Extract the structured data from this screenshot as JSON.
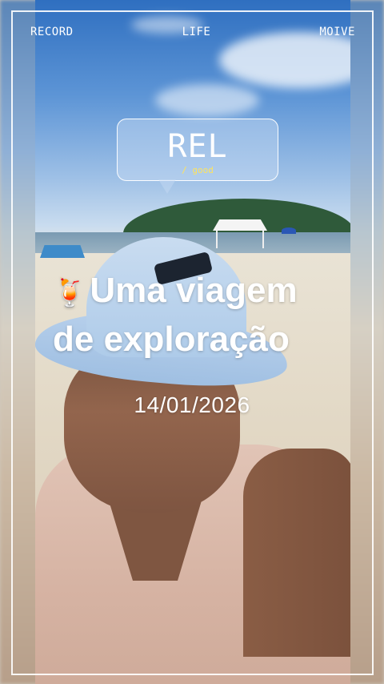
{
  "topbar": {
    "left": "RECORD",
    "center": "LIFE",
    "right": "MOIVE"
  },
  "bubble": {
    "title": "REL",
    "subtitle": "/ good"
  },
  "headline": {
    "emoji": "🍹",
    "line1": "Uma viagem",
    "line2": "de exploração"
  },
  "date": "14/01/2026",
  "colors": {
    "text": "#ffffff",
    "subtitle_accent": "#ffe45c",
    "frame": "#ffffff"
  }
}
